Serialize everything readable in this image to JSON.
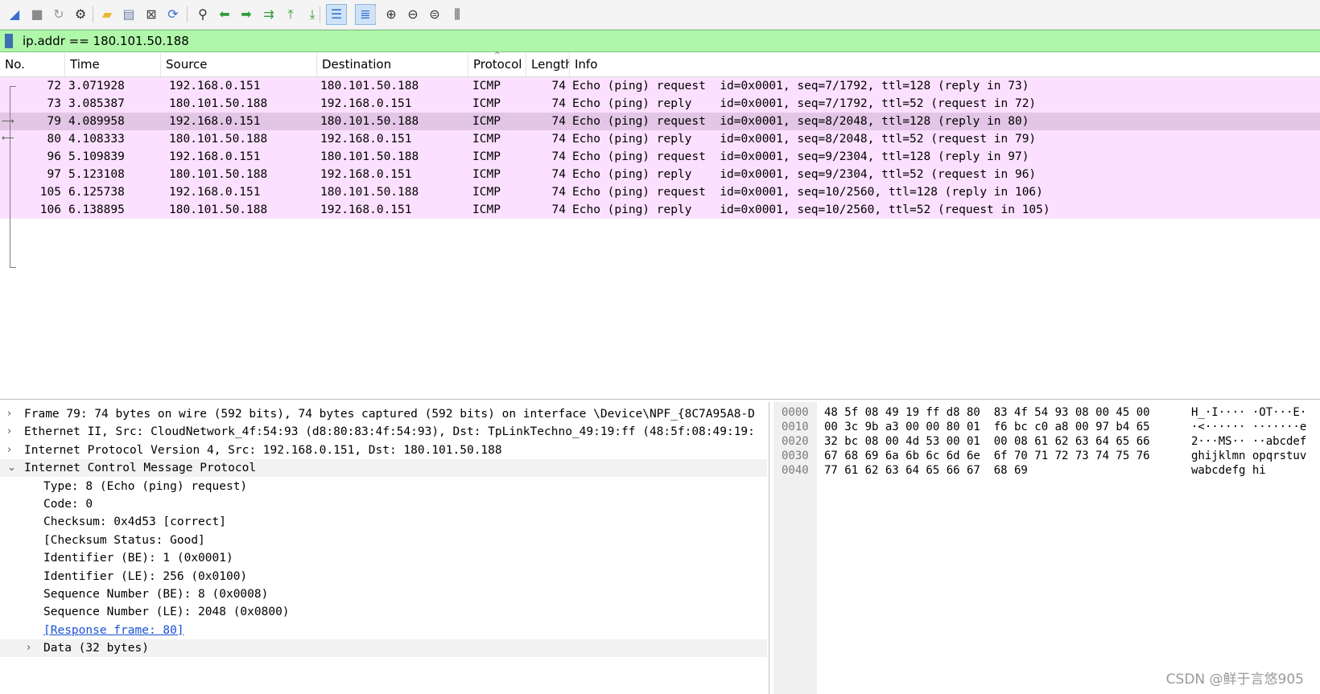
{
  "toolbar": {
    "buttons": [
      {
        "name": "start-capture-icon",
        "glyph": "◢",
        "color": "#3a6fd0"
      },
      {
        "name": "stop-capture-icon",
        "glyph": "■",
        "color": "#8a8a8a"
      },
      {
        "name": "restart-capture-icon",
        "glyph": "↻",
        "color": "#9a9a9a"
      },
      {
        "name": "capture-options-icon",
        "glyph": "⚙",
        "color": "#333333"
      },
      {
        "name": "open-file-icon",
        "glyph": "▰",
        "color": "#e8b830"
      },
      {
        "name": "save-file-icon",
        "glyph": "▤",
        "color": "#6a7fa8"
      },
      {
        "name": "close-file-icon",
        "glyph": "⊠",
        "color": "#444444"
      },
      {
        "name": "reload-file-icon",
        "glyph": "⟳",
        "color": "#3a6fd0"
      },
      {
        "name": "find-packet-icon",
        "glyph": "⚲",
        "color": "#333333"
      },
      {
        "name": "go-back-icon",
        "glyph": "⬅",
        "color": "#2f9e3a"
      },
      {
        "name": "go-forward-icon",
        "glyph": "➡",
        "color": "#2f9e3a"
      },
      {
        "name": "go-to-packet-icon",
        "glyph": "⇉",
        "color": "#2f9e3a"
      },
      {
        "name": "go-first-packet-icon",
        "glyph": "⤒",
        "color": "#2f9e3a"
      },
      {
        "name": "go-last-packet-icon",
        "glyph": "⤓",
        "color": "#2f9e3a"
      },
      {
        "name": "auto-scroll-icon",
        "glyph": "☰",
        "color": "#3a6fd0"
      },
      {
        "name": "colorize-icon",
        "glyph": "≣",
        "color": "#3a6fd0"
      },
      {
        "name": "zoom-in-icon",
        "glyph": "⊕",
        "color": "#333333"
      },
      {
        "name": "zoom-out-icon",
        "glyph": "⊖",
        "color": "#333333"
      },
      {
        "name": "normal-size-icon",
        "glyph": "⊜",
        "color": "#333333"
      },
      {
        "name": "resize-columns-icon",
        "glyph": "⫼",
        "color": "#333333"
      }
    ]
  },
  "filter": {
    "value": "ip.addr == 180.101.50.188"
  },
  "packet_list": {
    "headers": [
      "No.",
      "Time",
      "Source",
      "Destination",
      "Protocol",
      "Length",
      "Info"
    ],
    "rows": [
      {
        "no": "72",
        "time": "3.071928",
        "src": "192.168.0.151",
        "dst": "180.101.50.188",
        "proto": "ICMP",
        "len": "74",
        "info": "Echo (ping) request  id=0x0001, seq=7/1792, ttl=128 (reply in 73)"
      },
      {
        "no": "73",
        "time": "3.085387",
        "src": "180.101.50.188",
        "dst": "192.168.0.151",
        "proto": "ICMP",
        "len": "74",
        "info": "Echo (ping) reply    id=0x0001, seq=7/1792, ttl=52 (request in 72)"
      },
      {
        "no": "79",
        "time": "4.089958",
        "src": "192.168.0.151",
        "dst": "180.101.50.188",
        "proto": "ICMP",
        "len": "74",
        "info": "Echo (ping) request  id=0x0001, seq=8/2048, ttl=128 (reply in 80)",
        "selected": true
      },
      {
        "no": "80",
        "time": "4.108333",
        "src": "180.101.50.188",
        "dst": "192.168.0.151",
        "proto": "ICMP",
        "len": "74",
        "info": "Echo (ping) reply    id=0x0001, seq=8/2048, ttl=52 (request in 79)"
      },
      {
        "no": "96",
        "time": "5.109839",
        "src": "192.168.0.151",
        "dst": "180.101.50.188",
        "proto": "ICMP",
        "len": "74",
        "info": "Echo (ping) request  id=0x0001, seq=9/2304, ttl=128 (reply in 97)"
      },
      {
        "no": "97",
        "time": "5.123108",
        "src": "180.101.50.188",
        "dst": "192.168.0.151",
        "proto": "ICMP",
        "len": "74",
        "info": "Echo (ping) reply    id=0x0001, seq=9/2304, ttl=52 (request in 96)"
      },
      {
        "no": "105",
        "time": "6.125738",
        "src": "192.168.0.151",
        "dst": "180.101.50.188",
        "proto": "ICMP",
        "len": "74",
        "info": "Echo (ping) request  id=0x0001, seq=10/2560, ttl=128 (reply in 106)"
      },
      {
        "no": "106",
        "time": "6.138895",
        "src": "180.101.50.188",
        "dst": "192.168.0.151",
        "proto": "ICMP",
        "len": "74",
        "info": "Echo (ping) reply    id=0x0001, seq=10/2560, ttl=52 (request in 105)"
      }
    ]
  },
  "details": [
    {
      "arrow": "›",
      "text": "Frame 79: 74 bytes on wire (592 bits), 74 bytes captured (592 bits) on interface \\Device\\NPF_{8C7A95A8-D"
    },
    {
      "arrow": "›",
      "text": "Ethernet II, Src: CloudNetwork_4f:54:93 (d8:80:83:4f:54:93), Dst: TpLinkTechno_49:19:ff (48:5f:08:49:19:"
    },
    {
      "arrow": "›",
      "text": "Internet Protocol Version 4, Src: 192.168.0.151, Dst: 180.101.50.188"
    },
    {
      "arrow": "⌄",
      "text": "Internet Control Message Protocol"
    },
    {
      "text": "Type: 8 (Echo (ping) request)"
    },
    {
      "text": "Code: 0"
    },
    {
      "text": "Checksum: 0x4d53 [correct]"
    },
    {
      "text": "[Checksum Status: Good]"
    },
    {
      "text": "Identifier (BE): 1 (0x0001)"
    },
    {
      "text": "Identifier (LE): 256 (0x0100)"
    },
    {
      "text": "Sequence Number (BE): 8 (0x0008)"
    },
    {
      "text": "Sequence Number (LE): 2048 (0x0800)"
    },
    {
      "text": "[Response frame: 80]",
      "link": true
    },
    {
      "arrow": "›",
      "text": "Data (32 bytes)"
    }
  ],
  "bytes": [
    {
      "off": "0000",
      "hex": "48 5f 08 49 19 ff d8 80  83 4f 54 93 08 00 45 00",
      "ascii": "H_·I···· ·OT···E·"
    },
    {
      "off": "0010",
      "hex": "00 3c 9b a3 00 00 80 01  f6 bc c0 a8 00 97 b4 65",
      "ascii": "·<······ ·······e"
    },
    {
      "off": "0020",
      "hex": "32 bc 08 00 4d 53 00 01  00 08 61 62 63 64 65 66",
      "ascii": "2···MS·· ··abcdef"
    },
    {
      "off": "0030",
      "hex": "67 68 69 6a 6b 6c 6d 6e  6f 70 71 72 73 74 75 76",
      "ascii": "ghijklmn opqrstuv"
    },
    {
      "off": "0040",
      "hex": "77 61 62 63 64 65 66 67  68 69",
      "ascii": "wabcdefg hi"
    }
  ],
  "watermark": "CSDN @鲜于言悠905"
}
